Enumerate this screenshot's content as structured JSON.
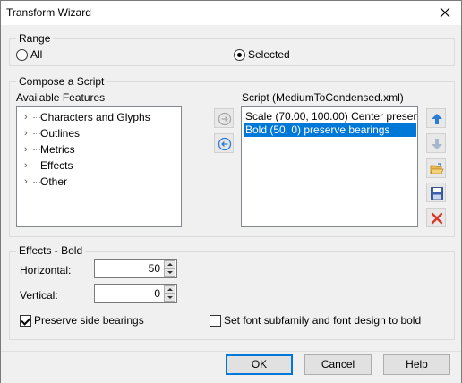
{
  "window": {
    "title": "Transform Wizard"
  },
  "range": {
    "label": "Range",
    "options": [
      {
        "label": "All",
        "checked": false
      },
      {
        "label": "Selected",
        "checked": true
      }
    ]
  },
  "compose": {
    "label": "Compose a Script",
    "available_label": "Available Features",
    "features": [
      "Characters and Glyphs",
      "Outlines",
      "Metrics",
      "Effects",
      "Other"
    ],
    "script_label": "Script (MediumToCondensed.xml)",
    "script_items": [
      {
        "text": "Scale (70.00, 100.00) Center preserve",
        "selected": false
      },
      {
        "text": "Bold (50, 0) preserve bearings",
        "selected": true
      }
    ],
    "icons": {
      "add": "arrow-right-circle-icon",
      "remove": "arrow-left-circle-icon",
      "up": "arrow-up-icon",
      "down": "arrow-down-icon",
      "open": "folder-open-icon",
      "save": "floppy-disk-icon",
      "delete": "red-x-icon"
    }
  },
  "effects": {
    "label": "Effects - Bold",
    "horizontal_label": "Horizontal:",
    "horizontal_value": "50",
    "vertical_label": "Vertical:",
    "vertical_value": "0",
    "preserve_label": "Preserve side bearings",
    "preserve_checked": true,
    "subfamily_label": "Set font subfamily and font design to bold",
    "subfamily_checked": false
  },
  "buttons": {
    "ok": "OK",
    "cancel": "Cancel",
    "help": "Help"
  },
  "colors": {
    "selection": "#0078d7",
    "accent_blue": "#2b7cd3",
    "delete_red": "#d9382a"
  }
}
